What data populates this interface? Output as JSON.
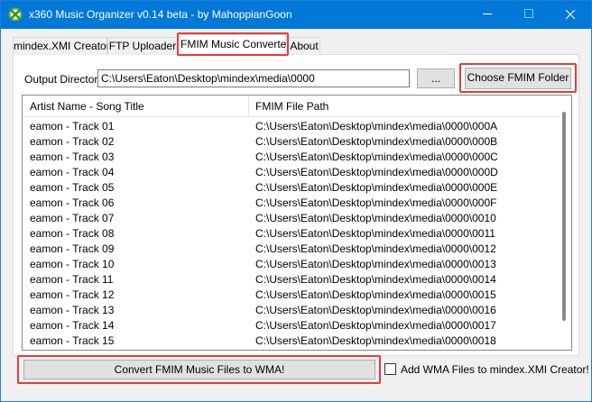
{
  "window": {
    "title": "x360 Music Organizer v0.14 beta - by MahoppianGoon",
    "accent_color": "#0078d7",
    "highlight_color": "#e63b3b",
    "icons": [
      "xbox-logo-icon",
      "minimize-icon",
      "maximize-icon",
      "close-icon"
    ]
  },
  "tabs": [
    {
      "label": "mindex.XMI Creator",
      "active": false
    },
    {
      "label": "FTP Uploader",
      "active": false
    },
    {
      "label": "FMIM Music Converter",
      "active": true
    },
    {
      "label": "About",
      "active": false
    }
  ],
  "converter": {
    "output_label": "Output Directory:",
    "output_value": "C:\\Users\\Eaton\\Desktop\\mindex\\media\\0000",
    "browse_label": "...",
    "choose_label": "Choose FMIM Folder",
    "columns": [
      "Artist Name - Song Title",
      "FMIM File Path"
    ],
    "rows": [
      {
        "name": "eamon - Track 01",
        "path": "C:\\Users\\Eaton\\Desktop\\mindex\\media\\0000\\000A"
      },
      {
        "name": "eamon - Track 02",
        "path": "C:\\Users\\Eaton\\Desktop\\mindex\\media\\0000\\000B"
      },
      {
        "name": "eamon - Track 03",
        "path": "C:\\Users\\Eaton\\Desktop\\mindex\\media\\0000\\000C"
      },
      {
        "name": "eamon - Track 04",
        "path": "C:\\Users\\Eaton\\Desktop\\mindex\\media\\0000\\000D"
      },
      {
        "name": "eamon - Track 05",
        "path": "C:\\Users\\Eaton\\Desktop\\mindex\\media\\0000\\000E"
      },
      {
        "name": "eamon - Track 06",
        "path": "C:\\Users\\Eaton\\Desktop\\mindex\\media\\0000\\000F"
      },
      {
        "name": "eamon - Track 07",
        "path": "C:\\Users\\Eaton\\Desktop\\mindex\\media\\0000\\0010"
      },
      {
        "name": "eamon - Track 08",
        "path": "C:\\Users\\Eaton\\Desktop\\mindex\\media\\0000\\0011"
      },
      {
        "name": "eamon - Track 09",
        "path": "C:\\Users\\Eaton\\Desktop\\mindex\\media\\0000\\0012"
      },
      {
        "name": "eamon - Track 10",
        "path": "C:\\Users\\Eaton\\Desktop\\mindex\\media\\0000\\0013"
      },
      {
        "name": "eamon - Track 11",
        "path": "C:\\Users\\Eaton\\Desktop\\mindex\\media\\0000\\0014"
      },
      {
        "name": "eamon - Track 12",
        "path": "C:\\Users\\Eaton\\Desktop\\mindex\\media\\0000\\0015"
      },
      {
        "name": "eamon - Track 13",
        "path": "C:\\Users\\Eaton\\Desktop\\mindex\\media\\0000\\0016"
      },
      {
        "name": "eamon - Track 14",
        "path": "C:\\Users\\Eaton\\Desktop\\mindex\\media\\0000\\0017"
      },
      {
        "name": "eamon - Track 15",
        "path": "C:\\Users\\Eaton\\Desktop\\mindex\\media\\0000\\0018"
      }
    ],
    "convert_label": "Convert FMIM Music Files to WMA!",
    "add_wma_label": "Add WMA Files to mindex.XMI Creator!",
    "add_wma_checked": false
  }
}
